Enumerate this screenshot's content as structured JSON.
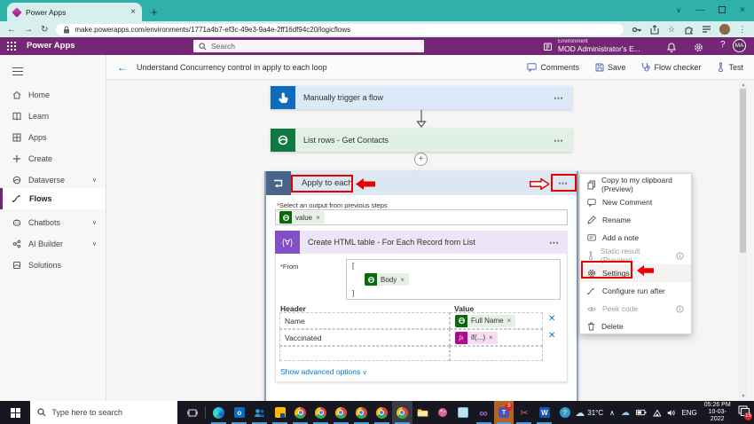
{
  "colors": {
    "accent_purple": "#742774",
    "browser_teal": "#2fb0a9",
    "highlight_red": "#e60000",
    "link_blue": "#0078d4"
  },
  "browser": {
    "tab_title": "Power Apps",
    "url": "make.powerapps.com/environments/1771a4b7-ef3c-49e3-9a4e-2ff16df94c20/logicflows"
  },
  "app_header": {
    "app_name": "Power Apps",
    "search_placeholder": "Search",
    "environment_label": "Environment",
    "environment_name": "MOD Administrator's E...",
    "avatar_initials": "MA"
  },
  "sidebar": {
    "items": [
      {
        "label": "Home"
      },
      {
        "label": "Learn"
      },
      {
        "label": "Apps"
      },
      {
        "label": "Create"
      },
      {
        "label": "Dataverse"
      },
      {
        "label": "Flows"
      },
      {
        "label": "Chatbots"
      },
      {
        "label": "AI Builder"
      },
      {
        "label": "Solutions"
      }
    ]
  },
  "flow_toolbar": {
    "title": "Understand Concurrency control in apply to each loop",
    "comments_label": "Comments",
    "save_label": "Save",
    "flow_checker_label": "Flow checker",
    "test_label": "Test"
  },
  "flow": {
    "trigger_title": "Manually trigger a flow",
    "list_rows_title": "List rows - Get Contacts",
    "apply_to_each": {
      "title": "Apply to each",
      "output_label": "Select an output from previous steps",
      "output_token": "value"
    },
    "create_html_table": {
      "title": "Create HTML table - For Each Record from List",
      "from_label": "From",
      "bracket_open": "[",
      "bracket_close": "]",
      "from_token": "Body",
      "columns": {
        "header": "Header",
        "value": "Value"
      },
      "rows": [
        {
          "header": "Name",
          "token": "Full Name"
        },
        {
          "header": "Vaccinated",
          "token": "if(...)"
        }
      ],
      "show_advanced_label": "Show advanced options"
    }
  },
  "context_menu": {
    "items": [
      {
        "label": "Copy to my clipboard (Preview)"
      },
      {
        "label": "New Comment"
      },
      {
        "label": "Rename"
      },
      {
        "label": "Add a note"
      },
      {
        "label": "Static result (Preview)"
      },
      {
        "label": "Settings"
      },
      {
        "label": "Configure run after"
      },
      {
        "label": "Peek code"
      },
      {
        "label": "Delete"
      }
    ]
  },
  "taskbar": {
    "search_placeholder": "Type here to search",
    "weather_temp": "31°C",
    "language_label": "ENG",
    "time": "05:26 PM",
    "date": "10-03-2022",
    "teams_badge": "9",
    "tray_badge": "15"
  }
}
